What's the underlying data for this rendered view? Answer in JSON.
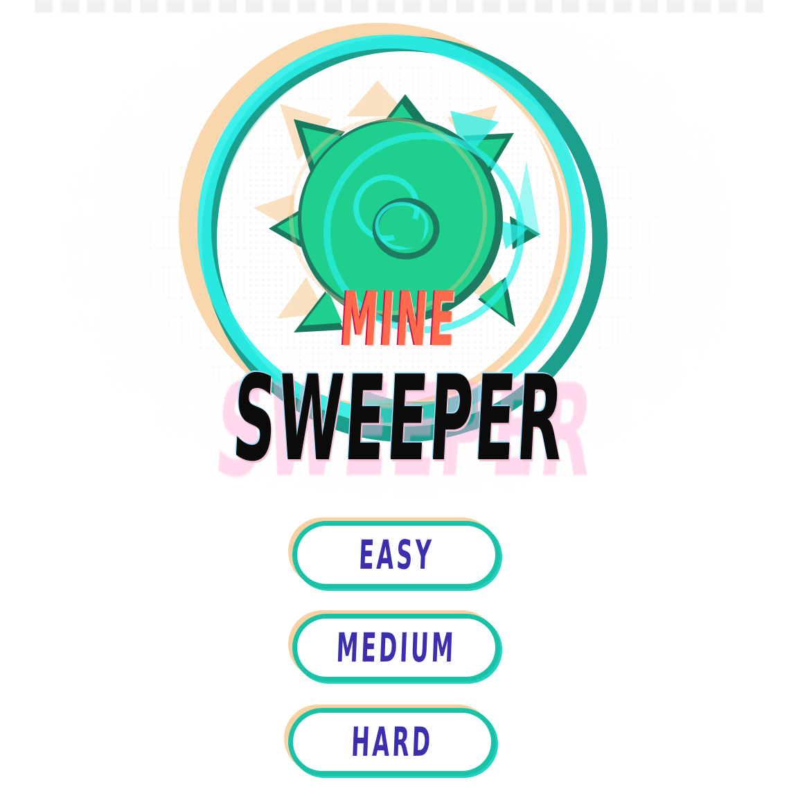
{
  "title": {
    "line1": "MINE",
    "line2": "SWEEPER"
  },
  "menu": {
    "buttons": [
      {
        "label": "EASY"
      },
      {
        "label": "MEDIUM"
      },
      {
        "label": "HARD"
      }
    ]
  },
  "colors": {
    "accent_teal": "#19c2a6",
    "mine_green": "#1fcf8e",
    "peach": "#f9d2a4",
    "cyan": "#2af0e8",
    "title_red": "#ff6a4d",
    "button_text": "#3b2fb0"
  },
  "icons": {
    "logo": "naval-mine-icon"
  }
}
